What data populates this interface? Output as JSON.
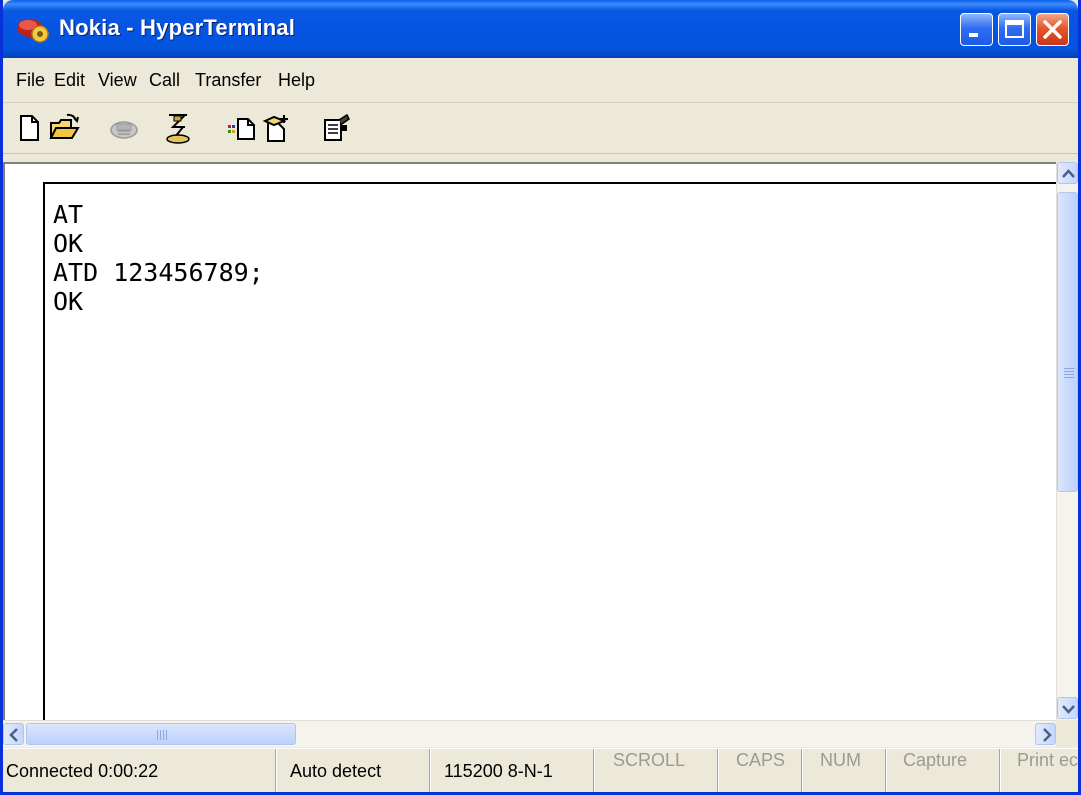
{
  "window": {
    "title": "Nokia - HyperTerminal",
    "app_icon": "hyperterminal-phone-icon",
    "controls": [
      "minimize-icon",
      "maximize-icon",
      "close-icon"
    ]
  },
  "menu": {
    "items": [
      {
        "label": "File"
      },
      {
        "label": "Edit"
      },
      {
        "label": "View"
      },
      {
        "label": "Call"
      },
      {
        "label": "Transfer"
      },
      {
        "label": "Help"
      }
    ]
  },
  "toolbar": {
    "buttons": [
      {
        "icon": "new-document-icon"
      },
      {
        "icon": "open-folder-icon"
      },
      {
        "icon": "disconnect-icon",
        "enabled": false
      },
      {
        "icon": "connect-icon"
      },
      {
        "icon": "send-file-icon"
      },
      {
        "icon": "receive-file-icon"
      },
      {
        "icon": "properties-icon"
      }
    ]
  },
  "terminal": {
    "lines": [
      "AT",
      "OK",
      "ATD 123456789;",
      "OK"
    ]
  },
  "statusbar": {
    "connected": "Connected 0:00:22",
    "detect": "Auto detect",
    "port_settings": "115200 8-N-1",
    "scroll": "SCROLL",
    "caps": "CAPS",
    "num": "NUM",
    "capture": "Capture",
    "print_echo": "Print ec"
  },
  "colors": {
    "titlebar": "#0554e3",
    "window_bg": "#ece9d8",
    "close_button": "#e4572c",
    "inactive_status_text": "#9c9a93"
  }
}
